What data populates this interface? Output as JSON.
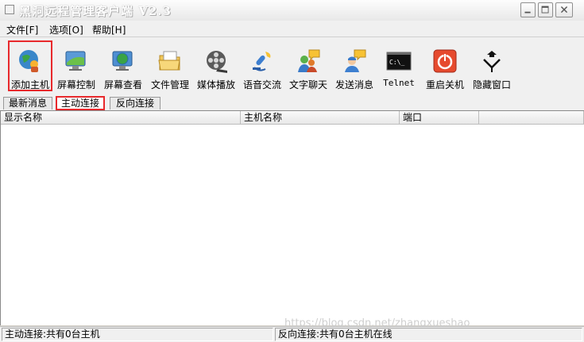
{
  "window": {
    "title": "黑洞远程管理客户端 V2.3"
  },
  "menu": {
    "items": [
      "文件[F]",
      "选项[O]",
      "帮助[H]"
    ]
  },
  "toolbar": {
    "items": [
      {
        "label": "添加主机",
        "icon": "add-host-icon"
      },
      {
        "label": "屏幕控制",
        "icon": "screen-control-icon"
      },
      {
        "label": "屏幕查看",
        "icon": "screen-view-icon"
      },
      {
        "label": "文件管理",
        "icon": "folder-icon"
      },
      {
        "label": "媒体播放",
        "icon": "film-reel-icon"
      },
      {
        "label": "语音交流",
        "icon": "voice-chat-icon"
      },
      {
        "label": "文字聊天",
        "icon": "text-chat-icon"
      },
      {
        "label": "发送消息",
        "icon": "send-message-icon"
      },
      {
        "label": "Telnet",
        "icon": "terminal-icon",
        "icon_text": "C:\\_"
      },
      {
        "label": "重启关机",
        "icon": "power-icon"
      },
      {
        "label": "隐藏窗口",
        "icon": "hide-window-icon"
      }
    ]
  },
  "tabs": [
    {
      "label": "最新消息",
      "active": false
    },
    {
      "label": "主动连接",
      "active": true
    },
    {
      "label": "反向连接",
      "active": false
    }
  ],
  "table": {
    "columns": [
      "显示名称",
      "主机名称",
      "端口",
      ""
    ],
    "rows": []
  },
  "watermark": "https://blog.csdn.net/zhangxueshao_",
  "status": {
    "left": "主动连接:共有0台主机",
    "right": "反向连接:共有0台主机在线"
  },
  "colors": {
    "highlight": "#e8292c",
    "background": "#f0f0f0"
  }
}
